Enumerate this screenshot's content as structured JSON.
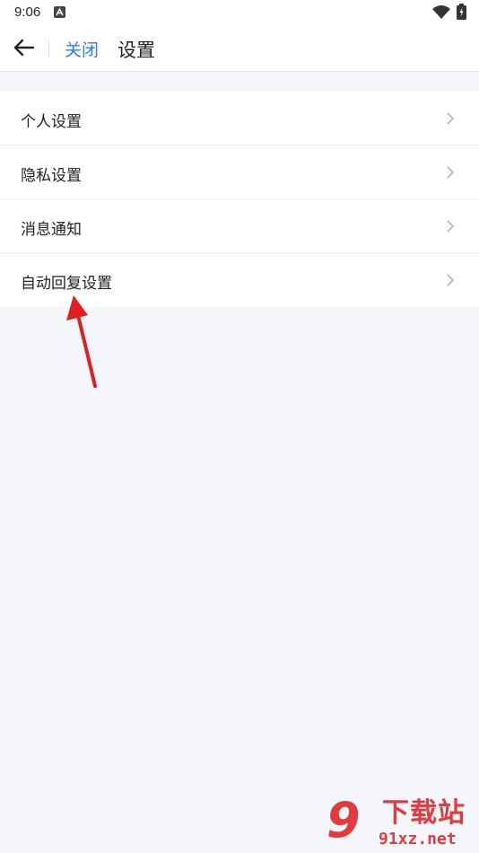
{
  "status_bar": {
    "time": "9:06"
  },
  "header": {
    "close_label": "关闭",
    "title": "设置"
  },
  "settings": {
    "items": [
      {
        "label": "个人设置"
      },
      {
        "label": "隐私设置"
      },
      {
        "label": "消息通知"
      },
      {
        "label": "自动回复设置"
      }
    ]
  },
  "watermark": {
    "name": "下载站",
    "domain": "91xz.net"
  },
  "colors": {
    "accent": "#2e7bf6",
    "background": "#f5f6f9",
    "annotation_arrow": "#e02020"
  },
  "icons": {
    "back": "arrow-left-icon",
    "chevron": "chevron-right-icon",
    "wifi": "wifi-icon",
    "battery": "battery-icon"
  }
}
